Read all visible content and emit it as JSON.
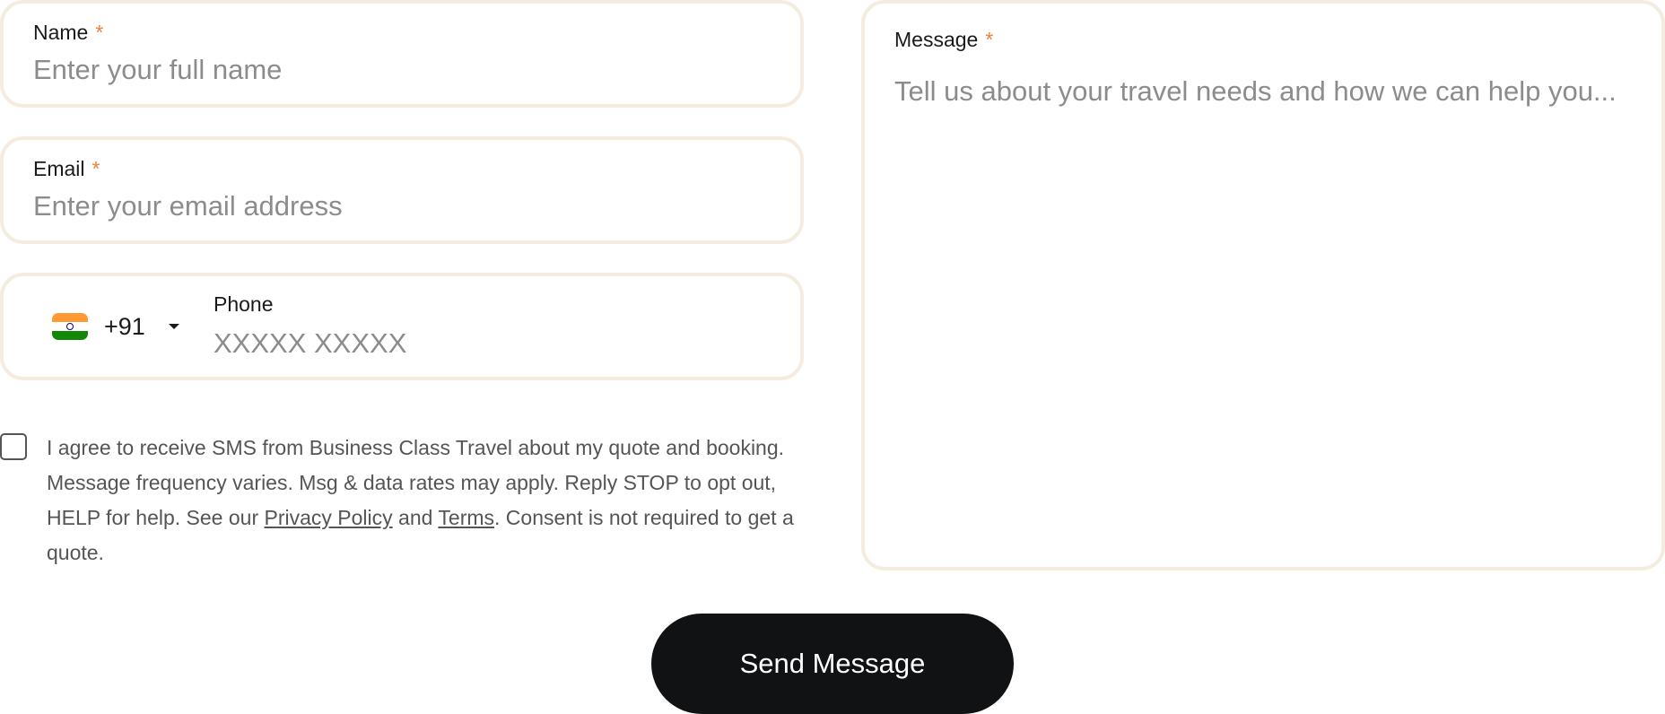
{
  "form": {
    "name": {
      "label": "Name",
      "required_mark": "*",
      "value": "",
      "placeholder": "Enter your full name"
    },
    "email": {
      "label": "Email",
      "required_mark": "*",
      "value": "",
      "placeholder": "Enter your email address"
    },
    "phone": {
      "country_flag": "india-flag-icon",
      "dial_code": "+91",
      "label": "Phone",
      "value": "",
      "placeholder": "XXXXX XXXXX"
    },
    "message": {
      "label": "Message",
      "required_mark": "*",
      "value": "",
      "placeholder": "Tell us about your travel needs and how we can help you..."
    },
    "consent": {
      "checked": false,
      "text_before": "I agree to receive SMS from Business Class Travel about my quote and booking. Message frequency varies. Msg & data rates may apply. Reply STOP to opt out, HELP for help. See our ",
      "privacy_link": "Privacy Policy",
      "text_and": " and ",
      "terms_link": "Terms",
      "text_after": ". Consent is not required to get a quote."
    },
    "submit_label": "Send Message"
  },
  "colors": {
    "field_border": "#f4ecdf",
    "required_accent": "#e8823a",
    "button_bg": "#111214",
    "placeholder": "#8c8c8c"
  }
}
